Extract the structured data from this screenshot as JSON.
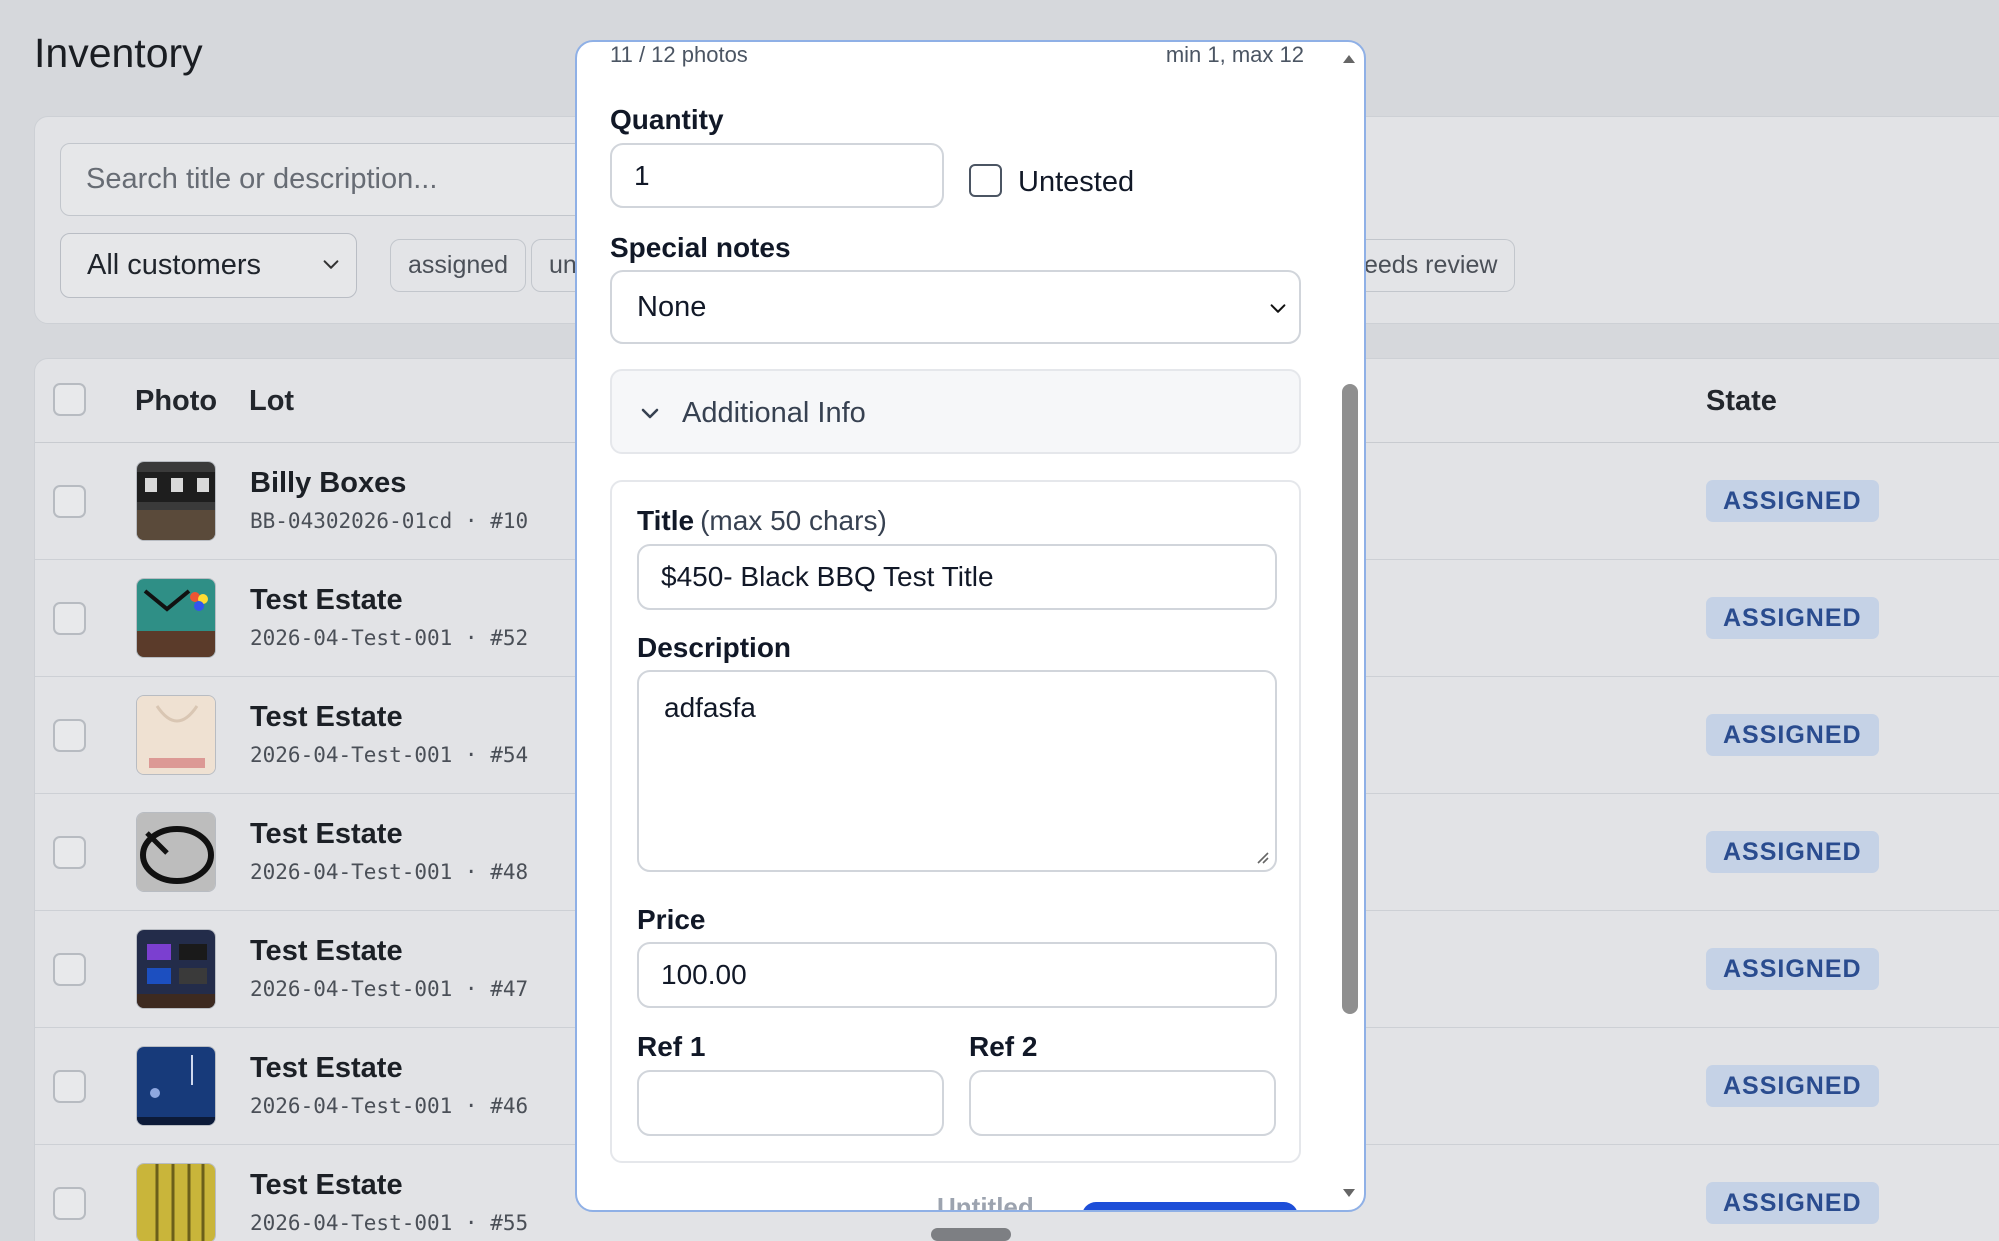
{
  "page": {
    "title": "Inventory",
    "search_placeholder": "Search title or description...",
    "customer_filter": "All customers",
    "chips": [
      "assigned",
      "un",
      "eeds review"
    ]
  },
  "table": {
    "headers": {
      "photo": "Photo",
      "lot": "Lot",
      "state": "State"
    },
    "rows": [
      {
        "name": "Billy Boxes",
        "code": "BB-04302026-01cd · #10",
        "state": "ASSIGNED",
        "thumb": "dark-device"
      },
      {
        "name": "Test Estate",
        "code": "2026-04-Test-001 · #52",
        "state": "ASSIGNED",
        "thumb": "pool-table"
      },
      {
        "name": "Test Estate",
        "code": "2026-04-Test-001 · #54",
        "state": "ASSIGNED",
        "thumb": "trader-bag"
      },
      {
        "name": "Test Estate",
        "code": "2026-04-Test-001 · #48",
        "state": "ASSIGNED",
        "thumb": "glasses"
      },
      {
        "name": "Test Estate",
        "code": "2026-04-Test-001 · #47",
        "state": "ASSIGNED",
        "thumb": "streaming-tv"
      },
      {
        "name": "Test Estate",
        "code": "2026-04-Test-001 · #46",
        "state": "ASSIGNED",
        "thumb": "blue-screen"
      },
      {
        "name": "Test Estate",
        "code": "2026-04-Test-001 · #55",
        "state": "ASSIGNED",
        "thumb": "yellow-item"
      }
    ]
  },
  "modal": {
    "photo_count": "11 / 12 photos",
    "photo_limits": "min 1, max 12",
    "quantity_label": "Quantity",
    "quantity_value": "1",
    "untested_label": "Untested",
    "untested_checked": false,
    "special_notes_label": "Special notes",
    "special_notes_value": "None",
    "additional_info_label": "Additional Info",
    "title_label": "Title",
    "title_hint": "(max 50 chars)",
    "title_value": "$450- Black BBQ Test Title",
    "description_label": "Description",
    "description_value": "adfasfa",
    "price_label": "Price",
    "price_value": "100.00",
    "ref1_label": "Ref 1",
    "ref1_value": "",
    "ref2_label": "Ref 2",
    "ref2_value": "",
    "footer_peek": "Untitled"
  },
  "colors": {
    "badge_bg": "#c5d2e6",
    "badge_text": "#2a4c8f",
    "modal_border": "#8fb0e6",
    "primary": "#1d4ed8"
  },
  "icons": {
    "dropdown": "chevron-down-icon",
    "accordion": "chevron-down-icon",
    "resize": "resize-grip-icon",
    "scroll_up": "triangle-up-icon",
    "scroll_down": "triangle-down-icon"
  }
}
